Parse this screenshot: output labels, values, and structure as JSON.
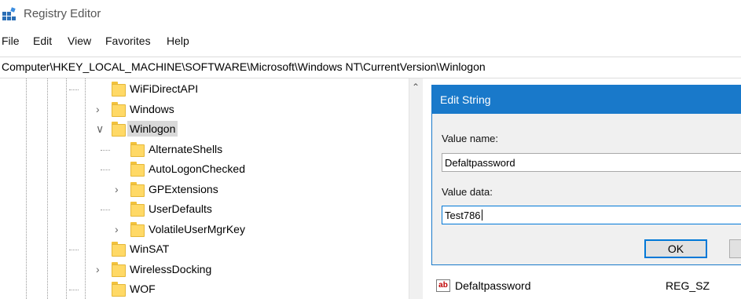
{
  "window": {
    "title": "Registry Editor",
    "app_icon": "registry-icon"
  },
  "menu": [
    "File",
    "Edit",
    "View",
    "Favorites",
    "Help"
  ],
  "address": "Computer\\HKEY_LOCAL_MACHINE\\SOFTWARE\\Microsoft\\Windows NT\\CurrentVersion\\Winlogon",
  "tree": {
    "items": [
      {
        "label": "WiFiDirectAPI",
        "level": 0,
        "expander": "none",
        "selected": false
      },
      {
        "label": "Windows",
        "level": 0,
        "expander": "collapsed",
        "selected": false
      },
      {
        "label": "Winlogon",
        "level": 0,
        "expander": "expanded",
        "selected": true
      },
      {
        "label": "AlternateShells",
        "level": 1,
        "expander": "none",
        "selected": false
      },
      {
        "label": "AutoLogonChecked",
        "level": 1,
        "expander": "none",
        "selected": false
      },
      {
        "label": "GPExtensions",
        "level": 1,
        "expander": "collapsed",
        "selected": false
      },
      {
        "label": "UserDefaults",
        "level": 1,
        "expander": "none",
        "selected": false
      },
      {
        "label": "VolatileUserMgrKey",
        "level": 1,
        "expander": "collapsed",
        "selected": false
      },
      {
        "label": "WinSAT",
        "level": 0,
        "expander": "none",
        "selected": false
      },
      {
        "label": "WirelessDocking",
        "level": 0,
        "expander": "collapsed",
        "selected": false
      },
      {
        "label": "WOF",
        "level": 0,
        "expander": "none",
        "selected": false
      }
    ]
  },
  "dialog": {
    "title": "Edit String",
    "value_name_label": "Value name:",
    "value_name": "Defaltpassword",
    "value_data_label": "Value data:",
    "value_data": "Test786",
    "ok_label": "OK"
  },
  "value_list": {
    "rows": [
      {
        "icon": "string-value-icon",
        "icon_text": "ab",
        "name": "Defaltpassword",
        "type": "REG_SZ"
      }
    ]
  },
  "colors": {
    "dialog_title": "#1979ca",
    "selection": "#d9d9d9",
    "folder": "#ffd966"
  }
}
